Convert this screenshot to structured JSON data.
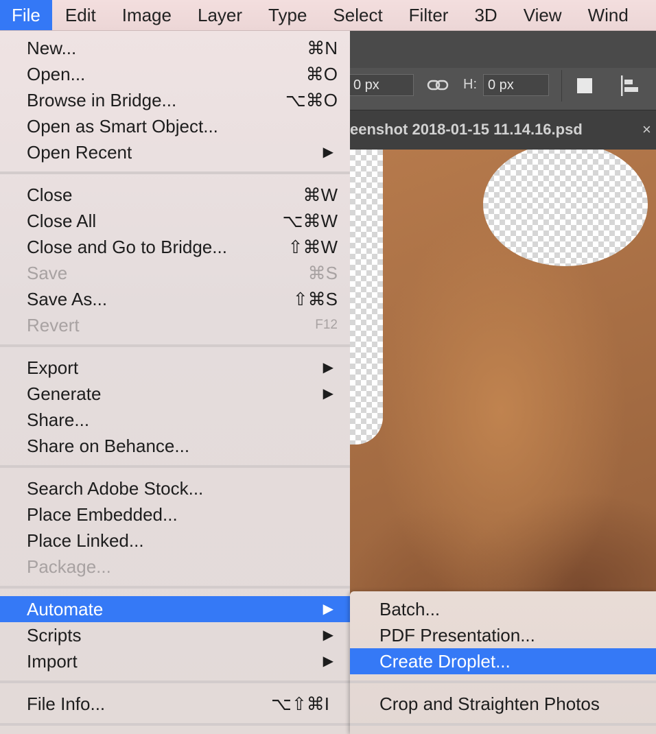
{
  "menubar": {
    "items": [
      "File",
      "Edit",
      "Image",
      "Layer",
      "Type",
      "Select",
      "Filter",
      "3D",
      "View",
      "Wind"
    ]
  },
  "options_bar": {
    "w_value": "0 px",
    "h_label": "H:",
    "h_value": "0 px"
  },
  "document_tab": {
    "title": "eenshot 2018-01-15 11.14.16.psd",
    "close": "×"
  },
  "file_menu": {
    "groups": [
      [
        {
          "label": "New...",
          "shortcut": "⌘N"
        },
        {
          "label": "Open...",
          "shortcut": "⌘O"
        },
        {
          "label": "Browse in Bridge...",
          "shortcut": "⌥⌘O"
        },
        {
          "label": "Open as Smart Object...",
          "shortcut": ""
        },
        {
          "label": "Open Recent",
          "submenu": "▶"
        }
      ],
      [
        {
          "label": "Close",
          "shortcut": "⌘W"
        },
        {
          "label": "Close All",
          "shortcut": "⌥⌘W"
        },
        {
          "label": "Close and Go to Bridge...",
          "shortcut": "⇧⌘W"
        },
        {
          "label": "Save",
          "shortcut": "⌘S",
          "disabled": true
        },
        {
          "label": "Save As...",
          "shortcut": "⇧⌘S"
        },
        {
          "label": "Revert",
          "shortcut": "F12",
          "disabled": true
        }
      ],
      [
        {
          "label": "Export",
          "submenu": "▶"
        },
        {
          "label": "Generate",
          "submenu": "▶"
        },
        {
          "label": "Share...",
          "shortcut": ""
        },
        {
          "label": "Share on Behance...",
          "shortcut": ""
        }
      ],
      [
        {
          "label": "Search Adobe Stock...",
          "shortcut": ""
        },
        {
          "label": "Place Embedded...",
          "shortcut": ""
        },
        {
          "label": "Place Linked...",
          "shortcut": ""
        },
        {
          "label": "Package...",
          "shortcut": "",
          "disabled": true
        }
      ],
      [
        {
          "label": "Automate",
          "submenu": "▶",
          "selected": true
        },
        {
          "label": "Scripts",
          "submenu": "▶"
        },
        {
          "label": "Import",
          "submenu": "▶"
        }
      ],
      [
        {
          "label": "File Info...",
          "shortcut": "⌥⇧⌘I"
        }
      ]
    ]
  },
  "automate_submenu": {
    "items": [
      "Batch...",
      "PDF Presentation...",
      "Create Droplet...",
      "Crop and Straighten Photos"
    ],
    "selected": "Create Droplet..."
  }
}
